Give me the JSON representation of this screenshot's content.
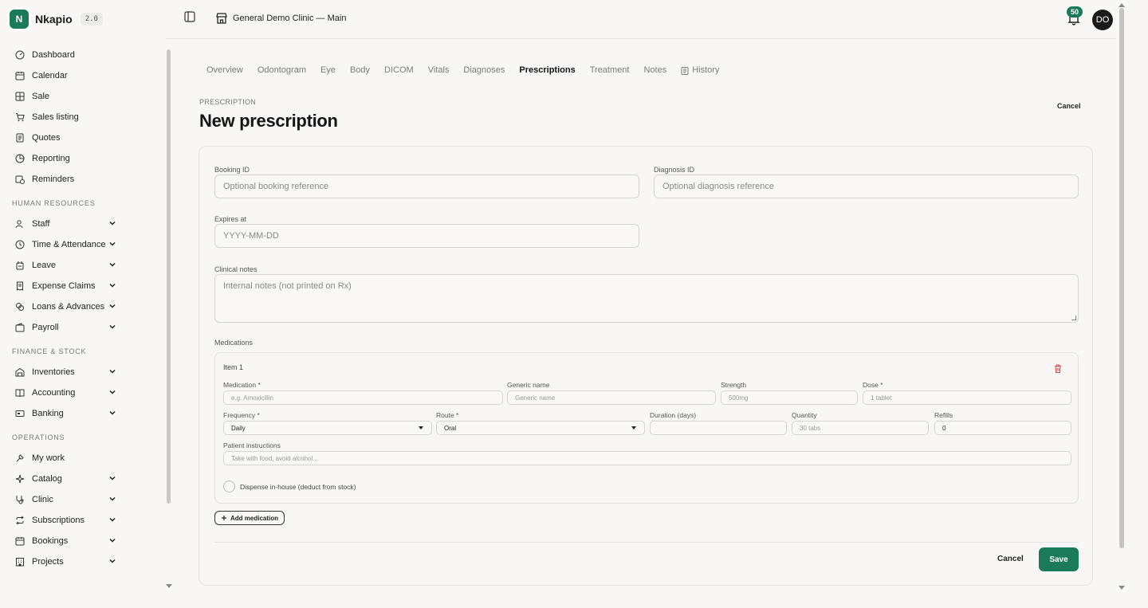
{
  "brand": {
    "logo_letter": "N",
    "name": "Nkapio",
    "version": "2.0"
  },
  "nav": {
    "main": [
      {
        "label": "Dashboard",
        "icon": "gauge-icon"
      },
      {
        "label": "Calendar",
        "icon": "calendar-icon"
      },
      {
        "label": "Sale",
        "icon": "grid-icon"
      },
      {
        "label": "Sales listing",
        "icon": "cart-icon"
      },
      {
        "label": "Quotes",
        "icon": "document-icon"
      },
      {
        "label": "Reporting",
        "icon": "pie-chart-icon"
      },
      {
        "label": "Reminders",
        "icon": "calendar-clock-icon"
      }
    ],
    "hr_title": "HUMAN RESOURCES",
    "hr": [
      {
        "label": "Staff",
        "icon": "users-icon"
      },
      {
        "label": "Time & Attendance",
        "icon": "clock-icon"
      },
      {
        "label": "Leave",
        "icon": "leave-icon"
      },
      {
        "label": "Expense Claims",
        "icon": "receipt-icon"
      },
      {
        "label": "Loans & Advances",
        "icon": "coins-icon"
      },
      {
        "label": "Payroll",
        "icon": "wallet-icon"
      }
    ],
    "finance_title": "FINANCE & STOCK",
    "finance": [
      {
        "label": "Inventories",
        "icon": "warehouse-icon"
      },
      {
        "label": "Accounting",
        "icon": "book-icon"
      },
      {
        "label": "Banking",
        "icon": "bank-card-icon"
      }
    ],
    "operations_title": "OPERATIONS",
    "operations": [
      {
        "label": "My work",
        "icon": "wrench-icon"
      },
      {
        "label": "Catalog",
        "icon": "sparkle-icon"
      },
      {
        "label": "Clinic",
        "icon": "stethoscope-icon"
      },
      {
        "label": "Subscriptions",
        "icon": "repeat-icon"
      },
      {
        "label": "Bookings",
        "icon": "calendar-icon"
      },
      {
        "label": "Projects",
        "icon": "building-icon"
      }
    ]
  },
  "topbar": {
    "clinic_name": "General Demo Clinic — Main",
    "notification_count": "50",
    "avatar_initials": "DO"
  },
  "tabs": [
    "Overview",
    "Odontogram",
    "Eye",
    "Body",
    "DICOM",
    "Vitals",
    "Diagnoses",
    "Prescriptions",
    "Treatment",
    "Notes",
    "History"
  ],
  "active_tab": "Prescriptions",
  "page": {
    "eyebrow": "PRESCRIPTION",
    "title": "New prescription",
    "cancel_label": "Cancel"
  },
  "form": {
    "booking_label": "Booking ID",
    "booking_placeholder": "Optional booking reference",
    "diagnosis_label": "Diagnosis ID",
    "diagnosis_placeholder": "Optional diagnosis reference",
    "expires_label": "Expires at",
    "expires_placeholder": "YYYY-MM-DD",
    "notes_label": "Clinical notes",
    "notes_placeholder": "Internal notes (not printed on Rx)",
    "medications_label": "Medications"
  },
  "medication": {
    "item_title": "Item 1",
    "medication_label": "Medication *",
    "medication_placeholder": "e.g. Amoxicillin",
    "generic_label": "Generic name",
    "generic_placeholder": "Generic name",
    "strength_label": "Strength",
    "strength_placeholder": "500mg",
    "dose_label": "Dose *",
    "dose_placeholder": "1 tablet",
    "frequency_label": "Frequency *",
    "frequency_value": "Daily",
    "route_label": "Route *",
    "route_value": "Oral",
    "duration_label": "Duration (days)",
    "duration_value": "",
    "quantity_label": "Quantity",
    "quantity_placeholder": "30 tabs",
    "refills_label": "Refills",
    "refills_value": "0",
    "instructions_label": "Patient instructions",
    "instructions_placeholder": "Take with food, avoid alcohol...",
    "dispense_label": "Dispense in-house (deduct from stock)"
  },
  "actions": {
    "add_medication": "Add medication",
    "cancel": "Cancel",
    "save": "Save"
  },
  "colors": {
    "accent": "#1b7a5a",
    "background": "#f8f7f5"
  }
}
